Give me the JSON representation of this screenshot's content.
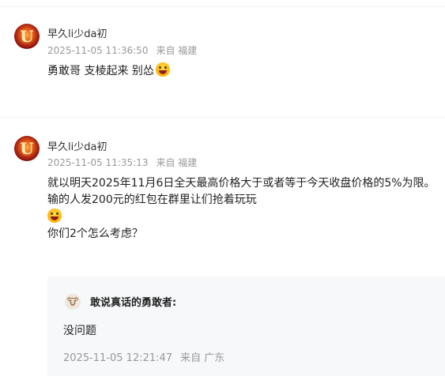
{
  "comments": [
    {
      "username": "早久li少da初",
      "datetime": "2025-11-05 11:36:50",
      "location": "来自 福建",
      "lines": [
        "勇敢哥 支棱起来 别怂"
      ],
      "emoji": "grinning-face-emoji"
    },
    {
      "username": "早久li少da初",
      "datetime": "2025-11-05 11:35:13",
      "location": "来自 福建",
      "lines": [
        "就以明天2025年11月6日全天最高价格大于或者等于今天收盘价格的5%为限。",
        "输的人发200元的红包在群里让们抢着玩玩",
        "你们2个怎么考虑？"
      ],
      "emoji": "grinning-face-emoji"
    }
  ],
  "reply": {
    "username": "敢说真话的勇敢者:",
    "text": "没问题",
    "datetime": "2025-11-05 12:21:47",
    "location": "来自 广东",
    "avatar_icon": "cow-avatar-icon"
  },
  "colors": {
    "meta_gray": "#999999",
    "reply_bg": "#f7f8fa",
    "text": "#222222"
  }
}
